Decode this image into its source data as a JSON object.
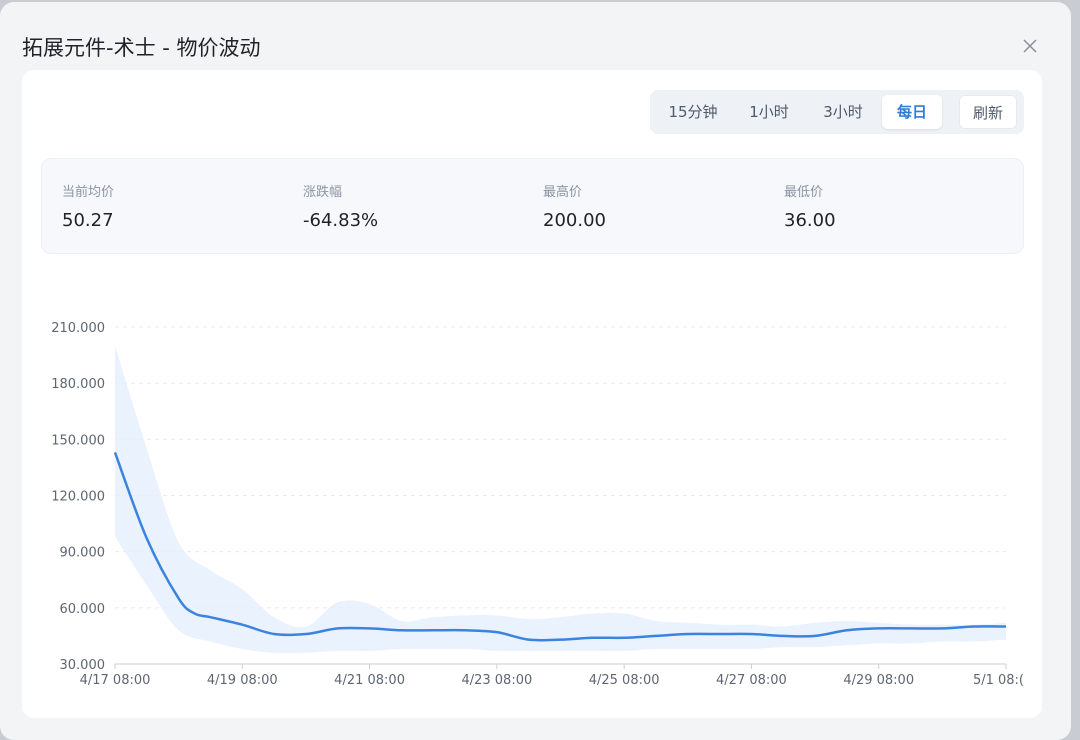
{
  "dialog": {
    "title": "拓展元件-术士 - 物价波动",
    "close_icon": "close-icon"
  },
  "range_tabs": [
    {
      "label": "15分钟",
      "active": false
    },
    {
      "label": "1小时",
      "active": false
    },
    {
      "label": "3小时",
      "active": false
    },
    {
      "label": "每日",
      "active": true
    }
  ],
  "refresh_label": "刷新",
  "stats": [
    {
      "label": "当前均价",
      "value": "50.27"
    },
    {
      "label": "涨跌幅",
      "value": "-64.83%"
    },
    {
      "label": "最高价",
      "value": "200.00"
    },
    {
      "label": "最低价",
      "value": "36.00"
    }
  ],
  "colors": {
    "accent": "#2f7cde",
    "line": "#3a84e0",
    "band": "#e3eefc"
  },
  "chart_data": {
    "type": "area",
    "ylim": [
      30,
      210
    ],
    "yticks": [
      "210.000",
      "180.000",
      "150.000",
      "120.000",
      "90.000",
      "60.000",
      "30.000"
    ],
    "xticks": [
      "4/17 08:00",
      "4/19 08:00",
      "4/21 08:00",
      "4/23 08:00",
      "4/25 08:00",
      "4/27 08:00",
      "4/29 08:00",
      "5/1 08:("
    ],
    "x_range_days": [
      0,
      14
    ],
    "grid": true,
    "series": [
      {
        "kind": "average_line",
        "x_days": [
          0,
          0.5,
          1,
          1.25,
          1.5,
          2,
          2.5,
          3,
          3.5,
          4,
          4.5,
          5,
          5.5,
          6,
          6.5,
          7,
          7.5,
          8,
          8.5,
          9,
          9.5,
          10,
          10.5,
          11,
          11.5,
          12,
          12.5,
          13,
          13.5,
          14
        ],
        "values": [
          143,
          97,
          65,
          57,
          55,
          51,
          46,
          46,
          49,
          49,
          48,
          48,
          48,
          47,
          43,
          43,
          44,
          44,
          45,
          46,
          46,
          46,
          45,
          45,
          48,
          49,
          49,
          49,
          50,
          50
        ]
      },
      {
        "kind": "range_upper",
        "x_days": [
          0,
          0.5,
          1,
          1.5,
          2,
          2.5,
          3,
          3.5,
          4,
          4.5,
          5,
          5.5,
          6,
          6.5,
          7,
          7.5,
          8,
          8.5,
          9,
          9.5,
          10,
          10.5,
          11,
          11.5,
          12,
          12.5,
          13,
          13.5,
          14
        ],
        "values": [
          200,
          145,
          95,
          80,
          70,
          55,
          50,
          63,
          62,
          53,
          55,
          56,
          56,
          54,
          55,
          57,
          57,
          53,
          52,
          51,
          51,
          50,
          52,
          53,
          52,
          51,
          51,
          51,
          52
        ]
      },
      {
        "kind": "range_lower",
        "x_days": [
          0,
          0.5,
          1,
          1.5,
          2,
          2.5,
          3,
          3.5,
          4,
          4.5,
          5,
          5.5,
          6,
          6.5,
          7,
          7.5,
          8,
          8.5,
          9,
          9.5,
          10,
          10.5,
          11,
          11.5,
          12,
          12.5,
          13,
          13.5,
          14
        ],
        "values": [
          98,
          72,
          48,
          42,
          38,
          36,
          36,
          37,
          37,
          38,
          38,
          38,
          37,
          37,
          37,
          37,
          37,
          38,
          38,
          38,
          38,
          39,
          39,
          40,
          41,
          41,
          42,
          42,
          43
        ]
      }
    ]
  }
}
